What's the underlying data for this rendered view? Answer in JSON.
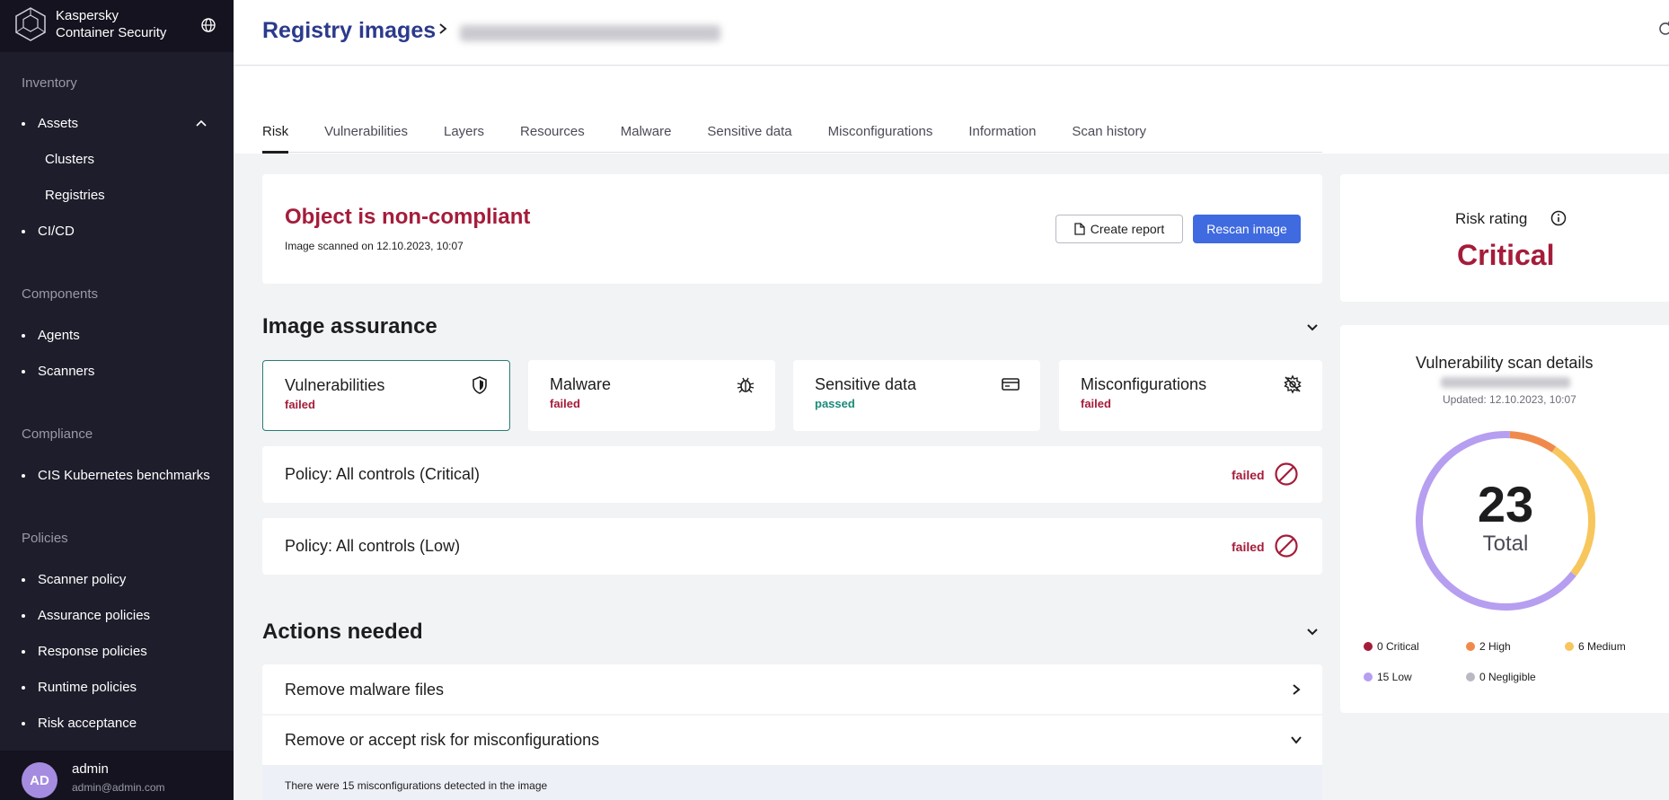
{
  "brand": {
    "line1": "Kaspersky",
    "line2": "Container Security"
  },
  "sidebar": {
    "sections": [
      {
        "label": "Inventory"
      },
      {
        "label": "Components"
      },
      {
        "label": "Compliance"
      },
      {
        "label": "Policies"
      }
    ],
    "items": {
      "assets": "Assets",
      "clusters": "Clusters",
      "registries": "Registries",
      "cicd": "CI/CD",
      "agents": "Agents",
      "scanners": "Scanners",
      "cis": "CIS Kubernetes benchmarks",
      "scanner_policy": "Scanner policy",
      "assurance_policies": "Assurance policies",
      "response_policies": "Response policies",
      "runtime_policies": "Runtime policies",
      "risk_acceptance": "Risk acceptance"
    }
  },
  "user": {
    "initials": "AD",
    "name": "admin",
    "email": "admin@admin.com"
  },
  "header": {
    "title": "Registry images"
  },
  "tabs": [
    "Risk",
    "Vulnerabilities",
    "Layers",
    "Resources",
    "Malware",
    "Sensitive data",
    "Misconfigurations",
    "Information",
    "Scan history"
  ],
  "status": {
    "title": "Object is non-compliant",
    "scanned": "Image scanned on 12.10.2023, 10:07",
    "create_report": "Create report",
    "rescan": "Rescan image"
  },
  "image_assurance": {
    "title": "Image assurance",
    "cards": [
      {
        "label": "Vulnerabilities",
        "status": "failed",
        "icon": "shield-icon"
      },
      {
        "label": "Malware",
        "status": "failed",
        "icon": "bug-icon"
      },
      {
        "label": "Sensitive data",
        "status": "passed",
        "icon": "card-icon"
      },
      {
        "label": "Misconfigurations",
        "status": "failed",
        "icon": "gear-off-icon"
      }
    ],
    "policies": [
      {
        "label": "Policy: All controls (Critical)",
        "status": "failed"
      },
      {
        "label": "Policy: All controls (Low)",
        "status": "failed"
      }
    ]
  },
  "actions": {
    "title": "Actions needed",
    "items": [
      {
        "label": "Remove malware files"
      },
      {
        "label": "Remove or accept risk for misconfigurations"
      }
    ],
    "detail": "There were 15 misconfigurations detected in the image"
  },
  "risk": {
    "label": "Risk rating",
    "value": "Critical"
  },
  "vuln_scan": {
    "title": "Vulnerability scan details",
    "updated": "Updated: 12.10.2023, 10:07",
    "total": "23",
    "total_label": "Total",
    "legend": [
      {
        "count": 0,
        "label": "0 Critical",
        "color": "#a51c3a"
      },
      {
        "count": 2,
        "label": "2 High",
        "color": "#f08a4b"
      },
      {
        "count": 6,
        "label": "6 Medium",
        "color": "#f7c65c"
      },
      {
        "count": 15,
        "label": "15 Low",
        "color": "#b69ef0"
      },
      {
        "count": 0,
        "label": "0 Negligible",
        "color": "#b8b9c2"
      }
    ]
  }
}
